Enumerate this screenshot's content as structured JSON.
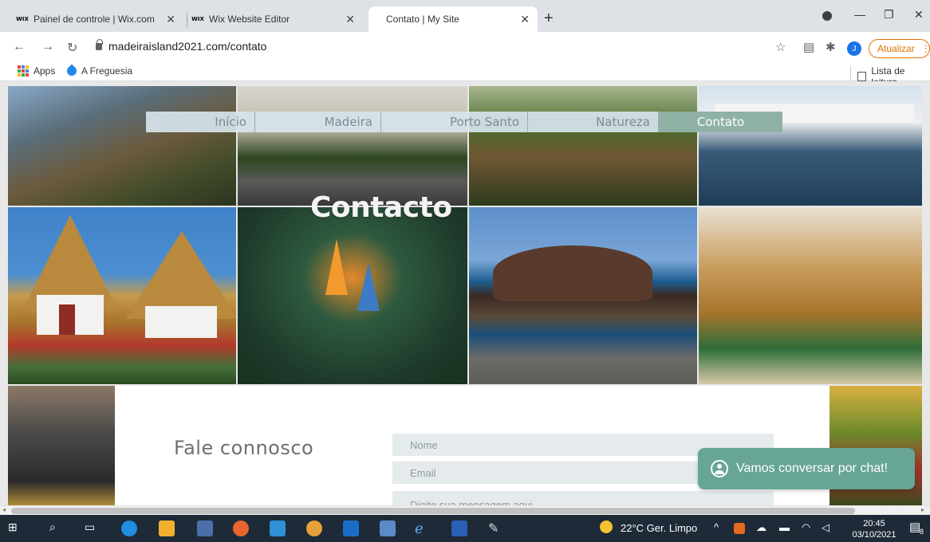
{
  "browser": {
    "tabs": [
      {
        "favicon": "WIX",
        "title": "Painel de controle | Wix.com"
      },
      {
        "favicon": "WIX",
        "title": "Wix Website Editor"
      },
      {
        "favicon": "",
        "title": "Contato | My Site"
      }
    ],
    "new_tab": "+",
    "url": "madeiraisland2021.com/contato",
    "avatar_initial": "J",
    "update_label": "Atualizar",
    "bookmarks": [
      "Apps",
      "A Freguesia"
    ],
    "reading_list": "Lista de leitura"
  },
  "site": {
    "menu": [
      "Início",
      "Madeira",
      "Porto Santo",
      "Natureza",
      "Contato"
    ],
    "active_menu": "Contato",
    "heading": "Contacto",
    "contact_title": "Fale connosco",
    "form": {
      "name_placeholder": "Nome",
      "email_placeholder": "Email",
      "message_placeholder": "Digite sua mensagem aqui..."
    },
    "chat_label": "Vamos conversar por chat!"
  },
  "taskbar": {
    "weather": "22°C  Ger. Limpo",
    "time": "20:45",
    "date": "03/10/2021",
    "notification_count": "8"
  },
  "colors": {
    "accent": "#8fb2a4",
    "chat": "#67a597",
    "update": "#e37400"
  }
}
